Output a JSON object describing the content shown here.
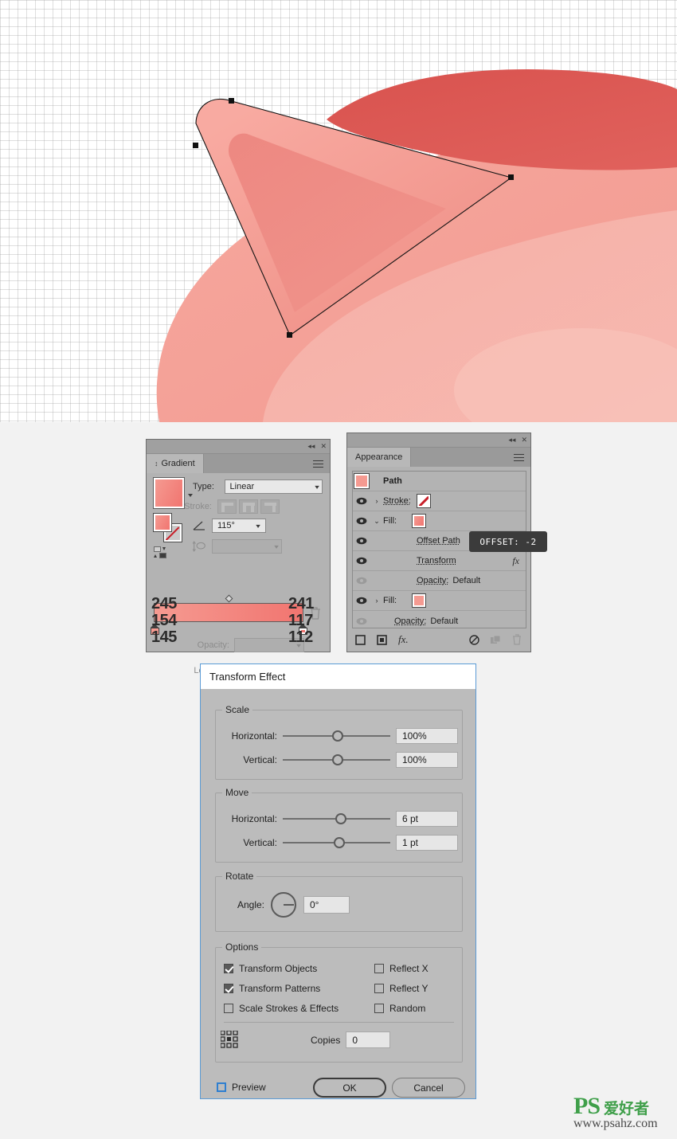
{
  "artboard": {
    "name": "illustrator-artboard",
    "grid": "transparency-grid",
    "selection": "triangular-petal-path",
    "colors": {
      "petal_light": "#f7a79d",
      "petal_mid": "#f1867e",
      "petal_dark": "#d9534f",
      "petal_pale": "#f6b4ab",
      "path_stroke": "#1a1a1a"
    }
  },
  "gradient_panel": {
    "title": "Gradient",
    "tab_label": "Gradient",
    "collapse_glyph": "◂◂",
    "close_glyph": "✕",
    "type_label": "Type:",
    "type_value": "Linear",
    "stroke_label": "Stroke:",
    "angle_value": "115°",
    "opacity_label": "Opacity:",
    "location_label": "Location:",
    "opacity_value": "",
    "location_value": "",
    "stops": {
      "left": {
        "r": "245",
        "g": "154",
        "b": "145",
        "hex": "#f59a91"
      },
      "right": {
        "r": "241",
        "g": "117",
        "b": "112",
        "hex": "#f17570"
      }
    }
  },
  "appearance_panel": {
    "title": "Appearance",
    "tab_label": "Appearance",
    "collapse_glyph": "◂◂",
    "close_glyph": "✕",
    "object_label": "Path",
    "rows": [
      {
        "label": "Stroke:",
        "swatch": "stroke-none",
        "arrow": "›",
        "eye": "on"
      },
      {
        "label": "Fill:",
        "swatch": "grad",
        "arrow": "⌄",
        "eye": "on"
      },
      {
        "label": "Offset Path",
        "swatch": "none",
        "arrow": "",
        "eye": "on"
      },
      {
        "label": "Transform",
        "swatch": "none",
        "arrow": "",
        "eye": "on",
        "fx": "fx"
      },
      {
        "label": "Opacity:",
        "value": "Default",
        "swatch": "none",
        "arrow": "",
        "eye": "dim"
      },
      {
        "label": "Fill:",
        "swatch": "solid",
        "arrow": "›",
        "eye": "on"
      },
      {
        "label": "Opacity:",
        "value": "Default",
        "swatch": "none",
        "arrow": "",
        "eye": "dim"
      }
    ],
    "footer_icons": [
      "add-new-stroke",
      "add-new-fill",
      "add-new-effect",
      "clear-appearance",
      "duplicate-item",
      "delete-item"
    ]
  },
  "tooltip": {
    "text": "OFFSET: -2"
  },
  "transform_dialog": {
    "title": "Transform Effect",
    "scale": {
      "legend": "Scale",
      "horizontal_label": "Horizontal:",
      "horizontal_value": "100%",
      "vertical_label": "Vertical:",
      "vertical_value": "100%"
    },
    "move": {
      "legend": "Move",
      "horizontal_label": "Horizontal:",
      "horizontal_value": "6 pt",
      "vertical_label": "Vertical:",
      "vertical_value": "1 pt"
    },
    "rotate": {
      "legend": "Rotate",
      "angle_label": "Angle:",
      "angle_value": "0°"
    },
    "options": {
      "legend": "Options",
      "transform_objects": {
        "label": "Transform Objects",
        "checked": true
      },
      "transform_patterns": {
        "label": "Transform Patterns",
        "checked": true
      },
      "scale_strokes": {
        "label": "Scale Strokes & Effects",
        "checked": false
      },
      "reflect_x": {
        "label": "Reflect X",
        "checked": false
      },
      "reflect_y": {
        "label": "Reflect Y",
        "checked": false
      },
      "random": {
        "label": "Random",
        "checked": false
      },
      "copies_label": "Copies",
      "copies_value": "0"
    },
    "preview_label": "Preview",
    "preview_checked": false,
    "ok_label": "OK",
    "cancel_label": "Cancel",
    "accent_color": "#5b9bd5"
  },
  "watermark": {
    "ps": "PS",
    "cn": "爱好者",
    "url": "www.psahz.com",
    "color": "#3f9f4a"
  }
}
